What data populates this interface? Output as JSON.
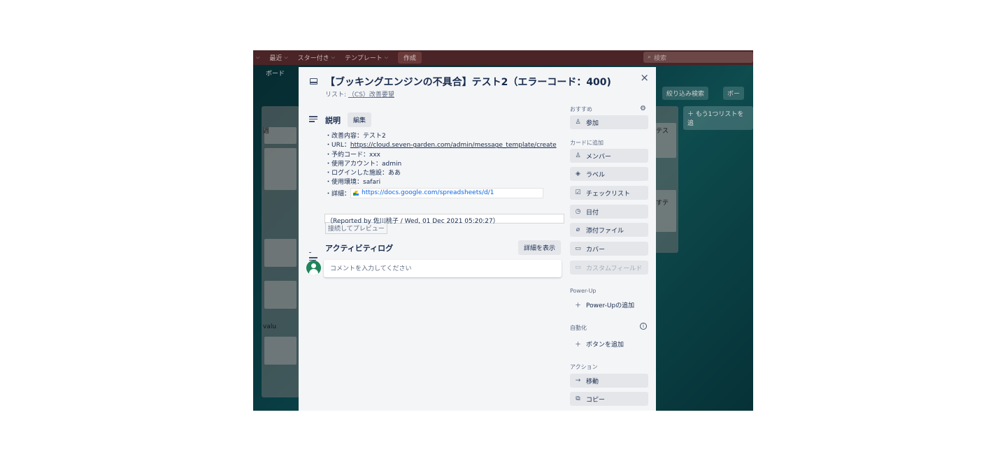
{
  "topbar": {
    "nav": [
      {
        "label": "最近"
      },
      {
        "label": "スター付き"
      },
      {
        "label": "テンプレート"
      }
    ],
    "create_label": "作成",
    "search_placeholder": "検索"
  },
  "background": {
    "board_button": "ボード",
    "filter_label": "絞り込み検索",
    "more_label": "ボー",
    "add_list_label": "もう1つリストを追",
    "left_col_fragments": [
      "週",
      "valu"
    ],
    "right_col_fragments": [
      "テス",
      "すテ"
    ]
  },
  "card": {
    "title": "【ブッキングエンジンの不具合】テスト2（エラーコード：400)",
    "list_prefix": "リスト: ",
    "list_name": "（CS）改善要望",
    "close_label": "×"
  },
  "description": {
    "heading": "説明",
    "edit_label": "編集",
    "lines": [
      "・改善内容：テスト2",
      "・URL：",
      "・予約コード：xxx",
      "・使用アカウント：admin",
      "・ログインした施設：ああ",
      "・使用環境：safari",
      "・詳細："
    ],
    "url": "https://cloud.seven-garden.com/admin/message_template/create",
    "doc_link": "https://docs.google.com/spreadsheets/d/1",
    "preview_label": "接続してプレビュー",
    "reported": "（Reported by 佐川桃子 / Wed, 01 Dec 2021 05:20:27）"
  },
  "activity": {
    "heading": "アクティビティログ",
    "details_label": "詳細を表示",
    "comment_placeholder": "コメントを入力してください"
  },
  "sidebar": {
    "suggested_label": "おすすめ",
    "join_label": "参加",
    "add_to_card_label": "カードに追加",
    "members_label": "メンバー",
    "labels_label": "ラベル",
    "checklist_label": "チェックリスト",
    "dates_label": "日付",
    "attachment_label": "添付ファイル",
    "cover_label": "カバー",
    "custom_fields_label": "カスタムフィールド",
    "powerup_section": "Power-Up",
    "add_powerup_label": "Power-Upの追加",
    "automation_section": "自動化",
    "add_button_label": "ボタンを追加",
    "actions_section": "アクション",
    "move_label": "移動",
    "copy_label": "コピー"
  }
}
